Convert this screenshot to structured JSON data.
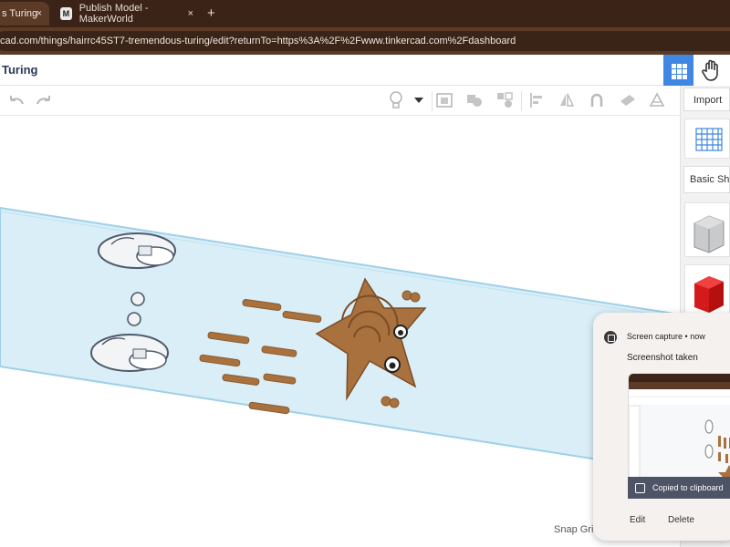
{
  "tabs": [
    {
      "label": "s Turing",
      "close": "×"
    },
    {
      "label": "Publish Model - MakerWorld",
      "close": "×",
      "favicon": "M"
    }
  ],
  "newtab": "+",
  "address": "cad.com/things/hairrc45ST7-tremendous-turing/edit?returnTo=https%3A%2F%2Fwww.tinkercad.com%2Fdashboard",
  "design_title": "Turing",
  "toolbar": {
    "icons": [
      "undo-icon",
      "redo-icon",
      "light-bulb-icon",
      "dropdown-icon",
      "workplane-icon",
      "group-icon",
      "ungroup-icon",
      "align-icon",
      "mirror-icon",
      "hole-icon",
      "cruise-icon",
      "ruler-icon"
    ]
  },
  "right_panel": {
    "import_label": "Import",
    "category_label": "Basic Sha"
  },
  "snap_label": "Snap Gri",
  "notification": {
    "source": "Screen capture • now",
    "title": "Screenshot taken",
    "copied": "Copied to clipboard",
    "edit": "Edit",
    "delete": "Delete"
  },
  "colors": {
    "tab_bar": "#3b2417",
    "address_bar": "#5b3a26",
    "accent_blue": "#3f87e0",
    "workplane": "#d9eef7",
    "shape_orange": "#a9713e",
    "red_box": "#e02020"
  }
}
